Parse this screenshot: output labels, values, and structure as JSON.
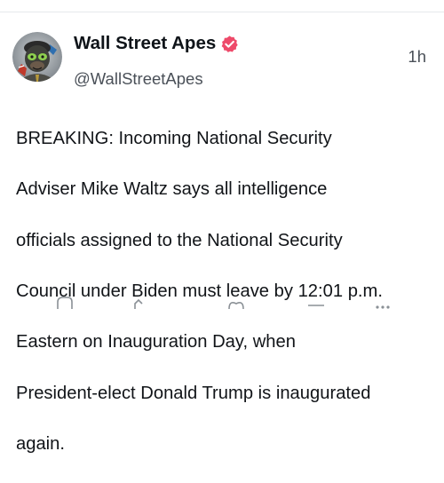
{
  "post": {
    "author": {
      "display_name": "Wall Street Apes",
      "handle": "@WallStreetApes",
      "verified": true,
      "avatar_icon": "ape-avatar-icon"
    },
    "timestamp": "1h",
    "body_lines": [
      "BREAKING: Incoming National Security",
      "Adviser Mike Waltz says all intelligence",
      "officials assigned to the National Security",
      "Council under Biden must leave by 12:01 p.m.",
      "Eastern on Inauguration Day, when",
      "President-elect Donald Trump is inaugurated",
      "again."
    ]
  },
  "colors": {
    "verified_badge": "#ee4a6a",
    "secondary_text": "#4a5058",
    "divider": "#e6e9ec"
  }
}
